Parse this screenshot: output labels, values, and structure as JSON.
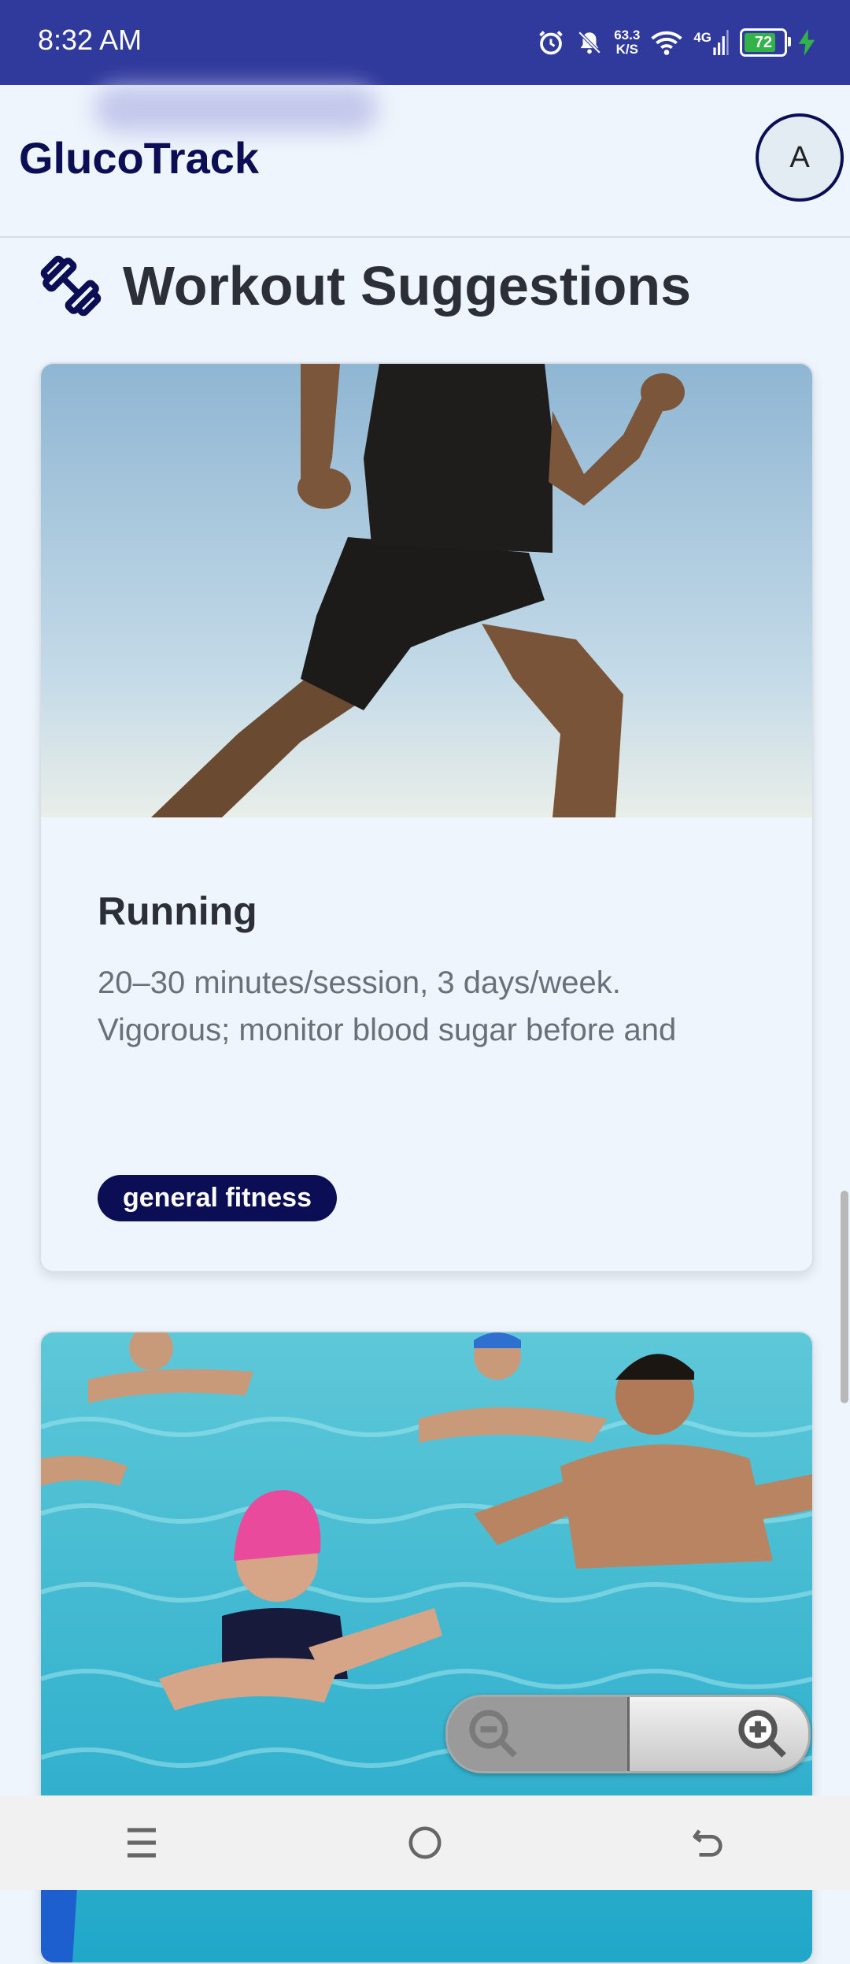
{
  "status_bar": {
    "time": "8:32 AM",
    "net_speed_value": "63.3",
    "net_speed_unit": "K/S",
    "network_type": "4G",
    "battery_level": "72"
  },
  "header": {
    "app_title": "GlucoTrack",
    "avatar_initial": "A"
  },
  "section": {
    "title": "Workout Suggestions",
    "icon": "dumbbell-icon"
  },
  "workouts": [
    {
      "title": "Running",
      "description": "20–30 minutes/session, 3 days/week. Vigorous; monitor blood sugar before and",
      "tag": "general fitness",
      "image": "running-photo"
    },
    {
      "image": "aqua-aerobics-photo"
    }
  ],
  "zoom": {
    "out_icon": "zoom-out-icon",
    "in_icon": "zoom-in-icon"
  },
  "nav": {
    "menu_icon": "menu-icon",
    "home_icon": "home-icon",
    "back_icon": "back-icon"
  },
  "colors": {
    "status_bar": "#30399c",
    "brand": "#0b0e54",
    "background": "#eef5fc"
  }
}
